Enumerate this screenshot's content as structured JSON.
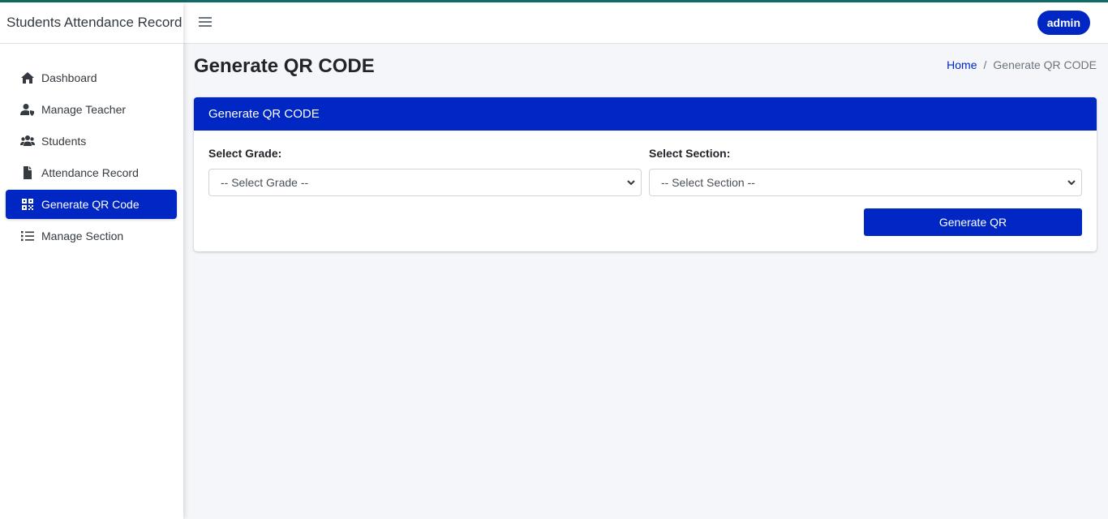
{
  "app": {
    "title": "Students Attendance Record"
  },
  "sidebar": {
    "items": [
      {
        "label": "Dashboard",
        "icon": "home-icon",
        "active": false
      },
      {
        "label": "Manage Teacher",
        "icon": "user-shield-icon",
        "active": false
      },
      {
        "label": "Students",
        "icon": "users-icon",
        "active": false
      },
      {
        "label": "Attendance Record",
        "icon": "file-icon",
        "active": false
      },
      {
        "label": "Generate QR Code",
        "icon": "qrcode-icon",
        "active": true
      },
      {
        "label": "Manage Section",
        "icon": "list-icon",
        "active": false
      }
    ]
  },
  "header": {
    "user_label": "admin",
    "menu_icon": "hamburger-icon"
  },
  "page": {
    "title": "Generate QR CODE",
    "breadcrumb": {
      "home": "Home",
      "separator": "/",
      "current": "Generate QR CODE"
    }
  },
  "card": {
    "title": "Generate QR CODE",
    "grade": {
      "label": "Select Grade:",
      "selected": "-- Select Grade --"
    },
    "section": {
      "label": "Select Section:",
      "selected": "-- Select Section --"
    },
    "submit_label": "Generate QR"
  },
  "colors": {
    "primary": "#0026c4",
    "topline": "#0f6b63",
    "background": "#f4f6f9"
  }
}
